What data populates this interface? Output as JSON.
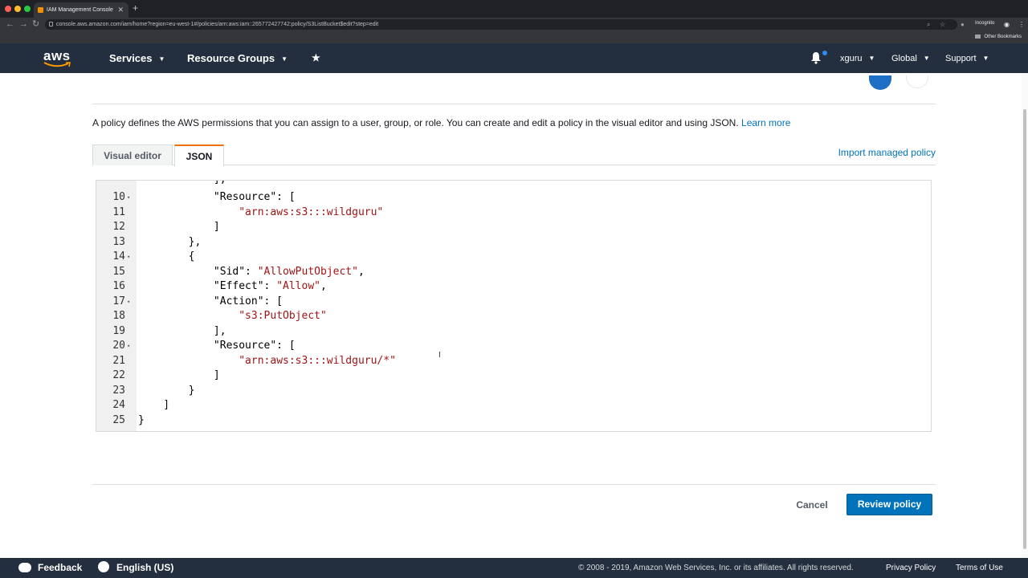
{
  "browser": {
    "tab_title": "IAM Management Console",
    "url": "console.aws.amazon.com/iam/home?region=eu-west-1#/policies/arn:aws:iam::265772427742:policy/S3ListBucket$edit?step=edit",
    "profile_label": "Incognito",
    "bookmarks_label": "Other Bookmarks"
  },
  "header": {
    "logo_text": "aws",
    "services": "Services",
    "resource_groups": "Resource Groups",
    "user": "xguru",
    "region": "Global",
    "support": "Support"
  },
  "content": {
    "description": "A policy defines the AWS permissions that you can assign to a user, group, or role. You can create and edit a policy in the visual editor and using JSON.",
    "learn_more": "Learn more",
    "tabs": [
      {
        "label": "Visual editor"
      },
      {
        "label": "JSON"
      }
    ],
    "import_link": "Import managed policy"
  },
  "editor": {
    "lines": [
      {
        "n": "10",
        "fold": "▾",
        "text": "            \"Resource\": ["
      },
      {
        "n": "11",
        "fold": "",
        "text": "                \"arn:aws:s3:::wildguru\""
      },
      {
        "n": "12",
        "fold": "",
        "text": "            ]"
      },
      {
        "n": "13",
        "fold": "",
        "text": "        },"
      },
      {
        "n": "14",
        "fold": "▾",
        "text": "        {"
      },
      {
        "n": "15",
        "fold": "",
        "text": "            \"Sid\": \"AllowPutObject\","
      },
      {
        "n": "16",
        "fold": "",
        "text": "            \"Effect\": \"Allow\","
      },
      {
        "n": "17",
        "fold": "▾",
        "text": "            \"Action\": ["
      },
      {
        "n": "18",
        "fold": "",
        "text": "                \"s3:PutObject\""
      },
      {
        "n": "19",
        "fold": "",
        "text": "            ],"
      },
      {
        "n": "20",
        "fold": "▾",
        "text": "            \"Resource\": ["
      },
      {
        "n": "21",
        "fold": "",
        "text": "                \"arn:aws:s3:::wildguru/*\""
      },
      {
        "n": "22",
        "fold": "",
        "text": "            ]"
      },
      {
        "n": "23",
        "fold": "",
        "text": "        }"
      },
      {
        "n": "24",
        "fold": "",
        "text": "    ]"
      },
      {
        "n": "25",
        "fold": "",
        "text": "}"
      }
    ]
  },
  "actions": {
    "cancel": "Cancel",
    "review": "Review policy"
  },
  "footer": {
    "feedback": "Feedback",
    "language": "English (US)",
    "copyright": "© 2008 - 2019, Amazon Web Services, Inc. or its affiliates. All rights reserved.",
    "privacy": "Privacy Policy",
    "terms": "Terms of Use"
  },
  "colors": {
    "nav_bg": "#232f3e",
    "accent_orange": "#ec7211",
    "primary_blue": "#0073bb",
    "string_red": "#a31515"
  }
}
